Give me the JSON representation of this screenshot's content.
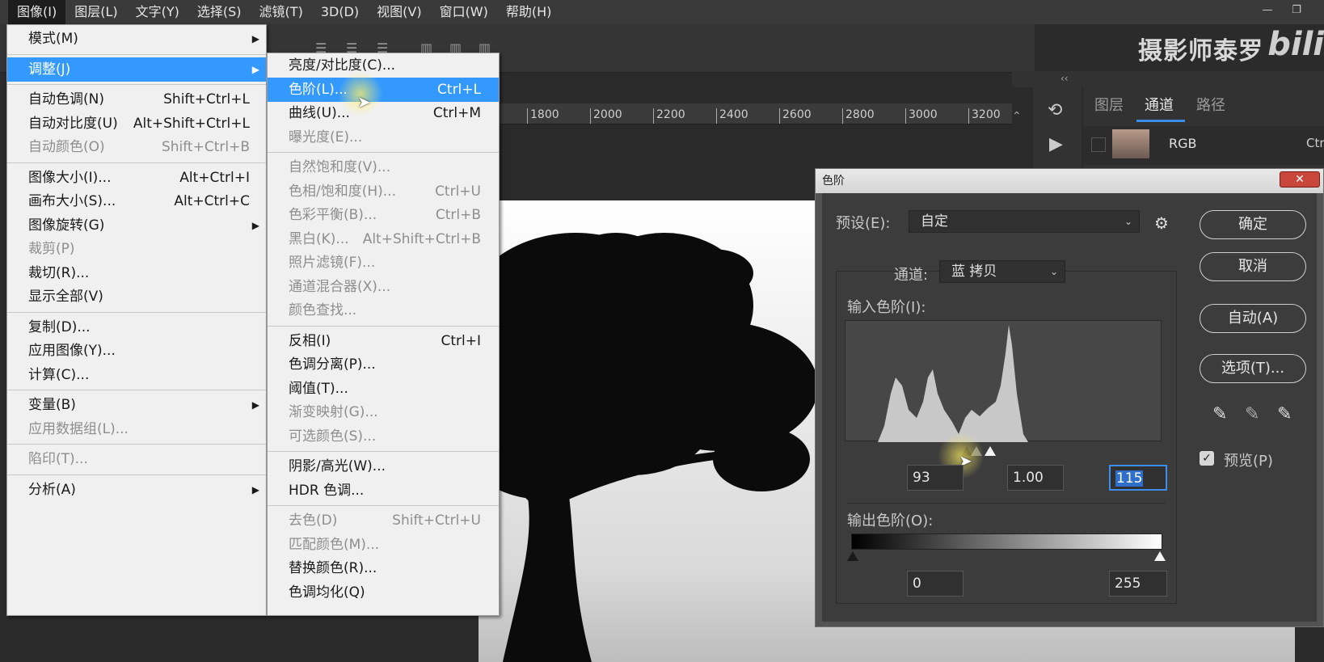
{
  "menubar": {
    "items": [
      "图像(I)",
      "图层(L)",
      "文字(Y)",
      "选择(S)",
      "滤镜(T)",
      "3D(D)",
      "视图(V)",
      "窗口(W)",
      "帮助(H)"
    ],
    "active": "图像(I)"
  },
  "watermark": "摄影师泰罗",
  "watermark_logo": "bili",
  "ruler": {
    "ticks": [
      "1800",
      "2000",
      "2200",
      "2400",
      "2600",
      "2800",
      "3000",
      "3200"
    ]
  },
  "panel": {
    "tabs": [
      "图层",
      "通道",
      "路径"
    ],
    "active_tab": "通道",
    "channel_row": {
      "name": "RGB",
      "shortcut": "Ctr"
    }
  },
  "image_menu": {
    "items": [
      {
        "label": "模式(M)",
        "submenu": true
      },
      {
        "label": "调整(J)",
        "submenu": true,
        "highlighted": true
      },
      {
        "label": "自动色调(N)",
        "shortcut": "Shift+Ctrl+L"
      },
      {
        "label": "自动对比度(U)",
        "shortcut": "Alt+Shift+Ctrl+L"
      },
      {
        "label": "自动颜色(O)",
        "shortcut": "Shift+Ctrl+B",
        "disabled": true
      },
      {
        "label": "图像大小(I)...",
        "shortcut": "Alt+Ctrl+I"
      },
      {
        "label": "画布大小(S)...",
        "shortcut": "Alt+Ctrl+C"
      },
      {
        "label": "图像旋转(G)",
        "submenu": true
      },
      {
        "label": "裁剪(P)",
        "disabled": true
      },
      {
        "label": "裁切(R)..."
      },
      {
        "label": "显示全部(V)"
      },
      {
        "label": "复制(D)..."
      },
      {
        "label": "应用图像(Y)..."
      },
      {
        "label": "计算(C)..."
      },
      {
        "label": "变量(B)",
        "submenu": true
      },
      {
        "label": "应用数据组(L)...",
        "disabled": true
      },
      {
        "label": "陷印(T)...",
        "disabled": true
      },
      {
        "label": "分析(A)",
        "submenu": true
      }
    ]
  },
  "adjust_menu": {
    "items": [
      {
        "label": "亮度/对比度(C)..."
      },
      {
        "label": "色阶(L)...",
        "shortcut": "Ctrl+L",
        "highlighted": true
      },
      {
        "label": "曲线(U)...",
        "shortcut": "Ctrl+M"
      },
      {
        "label": "曝光度(E)...",
        "disabled": true
      },
      {
        "label": "自然饱和度(V)...",
        "disabled": true
      },
      {
        "label": "色相/饱和度(H)...",
        "shortcut": "Ctrl+U",
        "disabled": true
      },
      {
        "label": "色彩平衡(B)...",
        "shortcut": "Ctrl+B",
        "disabled": true
      },
      {
        "label": "黑白(K)...",
        "shortcut": "Alt+Shift+Ctrl+B",
        "disabled": true
      },
      {
        "label": "照片滤镜(F)...",
        "disabled": true
      },
      {
        "label": "通道混合器(X)...",
        "disabled": true
      },
      {
        "label": "颜色查找...",
        "disabled": true
      },
      {
        "label": "反相(I)",
        "shortcut": "Ctrl+I"
      },
      {
        "label": "色调分离(P)..."
      },
      {
        "label": "阈值(T)..."
      },
      {
        "label": "渐变映射(G)...",
        "disabled": true
      },
      {
        "label": "可选颜色(S)...",
        "disabled": true
      },
      {
        "label": "阴影/高光(W)..."
      },
      {
        "label": "HDR 色调..."
      },
      {
        "label": "去色(D)",
        "shortcut": "Shift+Ctrl+U",
        "disabled": true
      },
      {
        "label": "匹配颜色(M)...",
        "disabled": true
      },
      {
        "label": "替换颜色(R)..."
      },
      {
        "label": "色调均化(Q)"
      }
    ]
  },
  "levels": {
    "title": "色阶",
    "close": "✕",
    "preset_label": "预设(E):",
    "preset_value": "自定",
    "channel_label": "通道:",
    "channel_value": "蓝 拷贝",
    "input_label": "输入色阶(I):",
    "input_black": "93",
    "input_gamma": "1.00",
    "input_white": "115",
    "output_label": "输出色阶(O):",
    "output_black": "0",
    "output_white": "255",
    "buttons": {
      "ok": "确定",
      "cancel": "取消",
      "auto": "自动(A)",
      "options": "选项(T)..."
    },
    "preview_label": "预览(P)",
    "preview_checked": true
  }
}
